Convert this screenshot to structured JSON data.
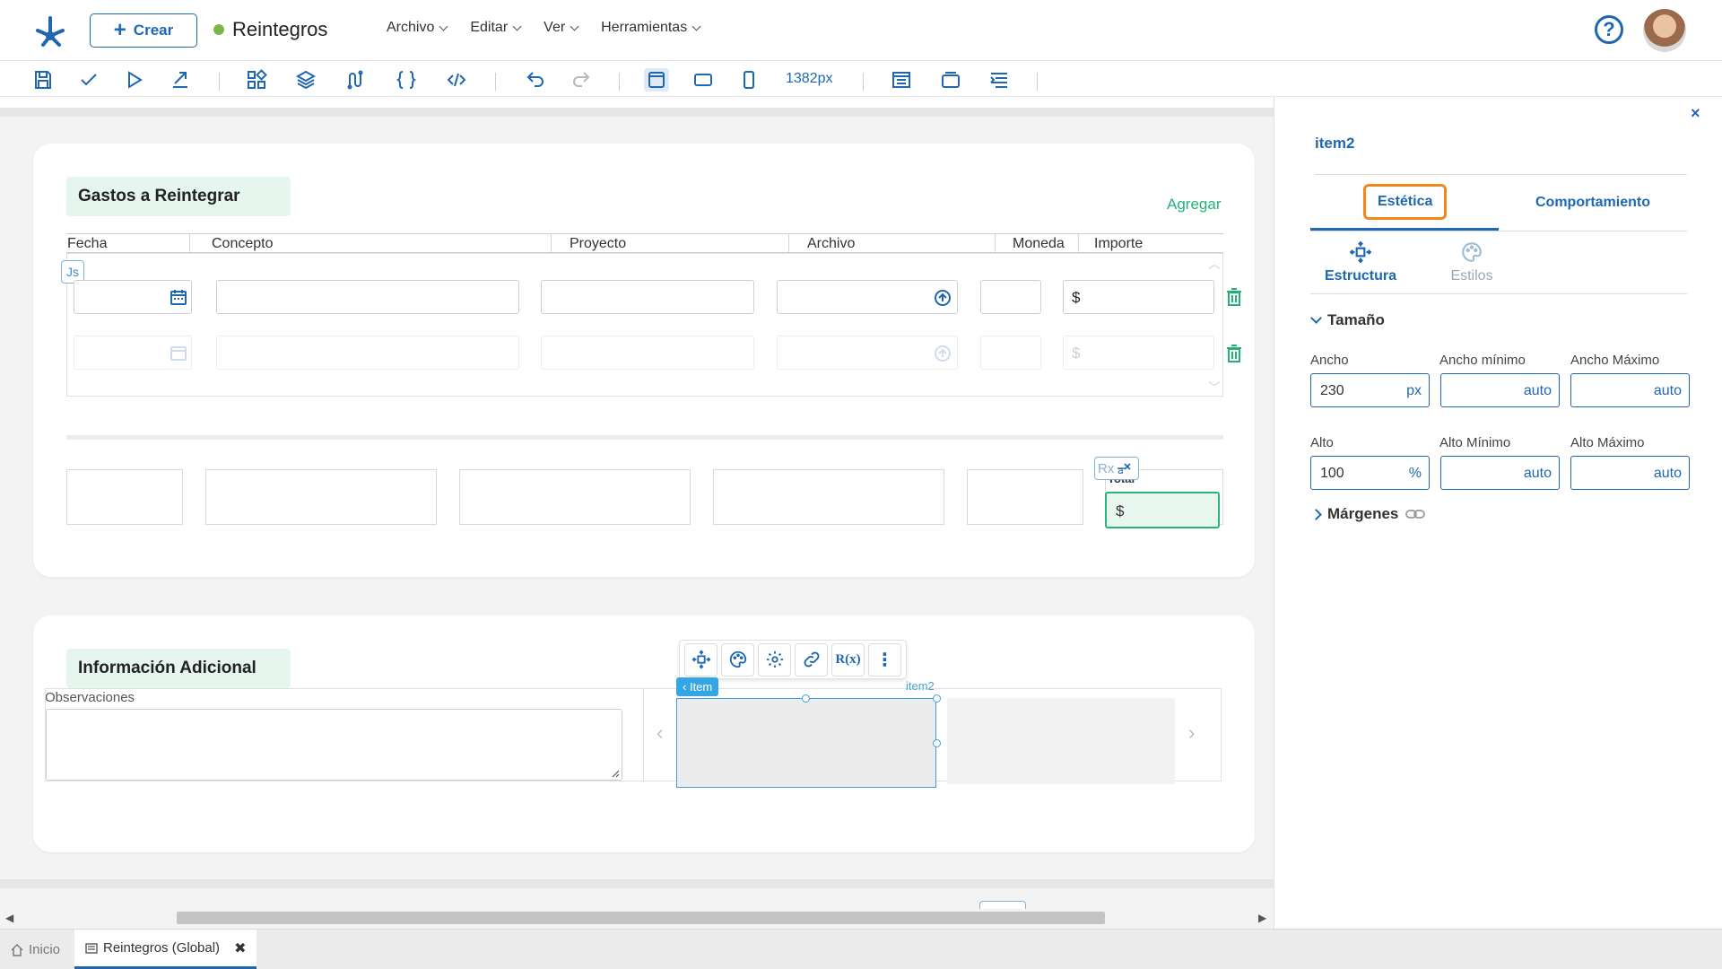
{
  "header": {
    "create_label": "Crear",
    "doc_title": "Reintegros",
    "status_color": "#7ab648",
    "menu": [
      "Archivo",
      "Editar",
      "Ver",
      "Herramientas"
    ],
    "help_icon": "help-circle-icon",
    "avatar": "user-avatar"
  },
  "toolbar": {
    "icons": [
      "save-icon",
      "check-icon",
      "play-icon",
      "export-icon",
      "components-icon",
      "layers-icon",
      "flow-icon",
      "braces-icon",
      "code-icon",
      "undo-icon",
      "redo-icon",
      "desktop-view-icon",
      "tablet-view-icon",
      "mobile-view-icon",
      "layout-icon",
      "window-icon",
      "align-icon"
    ],
    "width_label": "1382px"
  },
  "section1": {
    "title": "Gastos a Reintegrar",
    "add_label": "Agregar",
    "columns": [
      "Fecha",
      "Concepto",
      "Proyecto",
      "Archivo",
      "Moneda",
      "Importe"
    ],
    "currency_symbol": "$",
    "js_badge": "Js",
    "rx_badge": "Rx",
    "total_label": "Total",
    "total_value": "$"
  },
  "section2": {
    "title": "Información Adicional",
    "observations_label": "Observaciones",
    "item_tag": "Item",
    "item2_label": "item2",
    "rx_tool": "R(x)"
  },
  "panel": {
    "title": "item2",
    "tabs": [
      "Estética",
      "Comportamiento"
    ],
    "subtabs": [
      "Estructura",
      "Estilos"
    ],
    "size_section": "Tamaño",
    "margins_section": "Márgenes",
    "fields": {
      "ancho": {
        "label": "Ancho",
        "value": "230",
        "unit": "px"
      },
      "ancho_min": {
        "label": "Ancho mínimo",
        "value": "auto"
      },
      "ancho_max": {
        "label": "Ancho Máximo",
        "value": "auto"
      },
      "alto": {
        "label": "Alto",
        "value": "100",
        "unit": "%"
      },
      "alto_min": {
        "label": "Alto Mínimo",
        "value": "auto"
      },
      "alto_max": {
        "label": "Alto Máximo",
        "value": "auto"
      }
    },
    "close_label": "×",
    "highlight_color": "#f0881a"
  },
  "bottom_tabs": [
    {
      "label": "Inicio"
    },
    {
      "label": "Reintegros (Global)"
    }
  ],
  "colors": {
    "primary": "#1f67b1",
    "accent_green": "#21b27a"
  }
}
